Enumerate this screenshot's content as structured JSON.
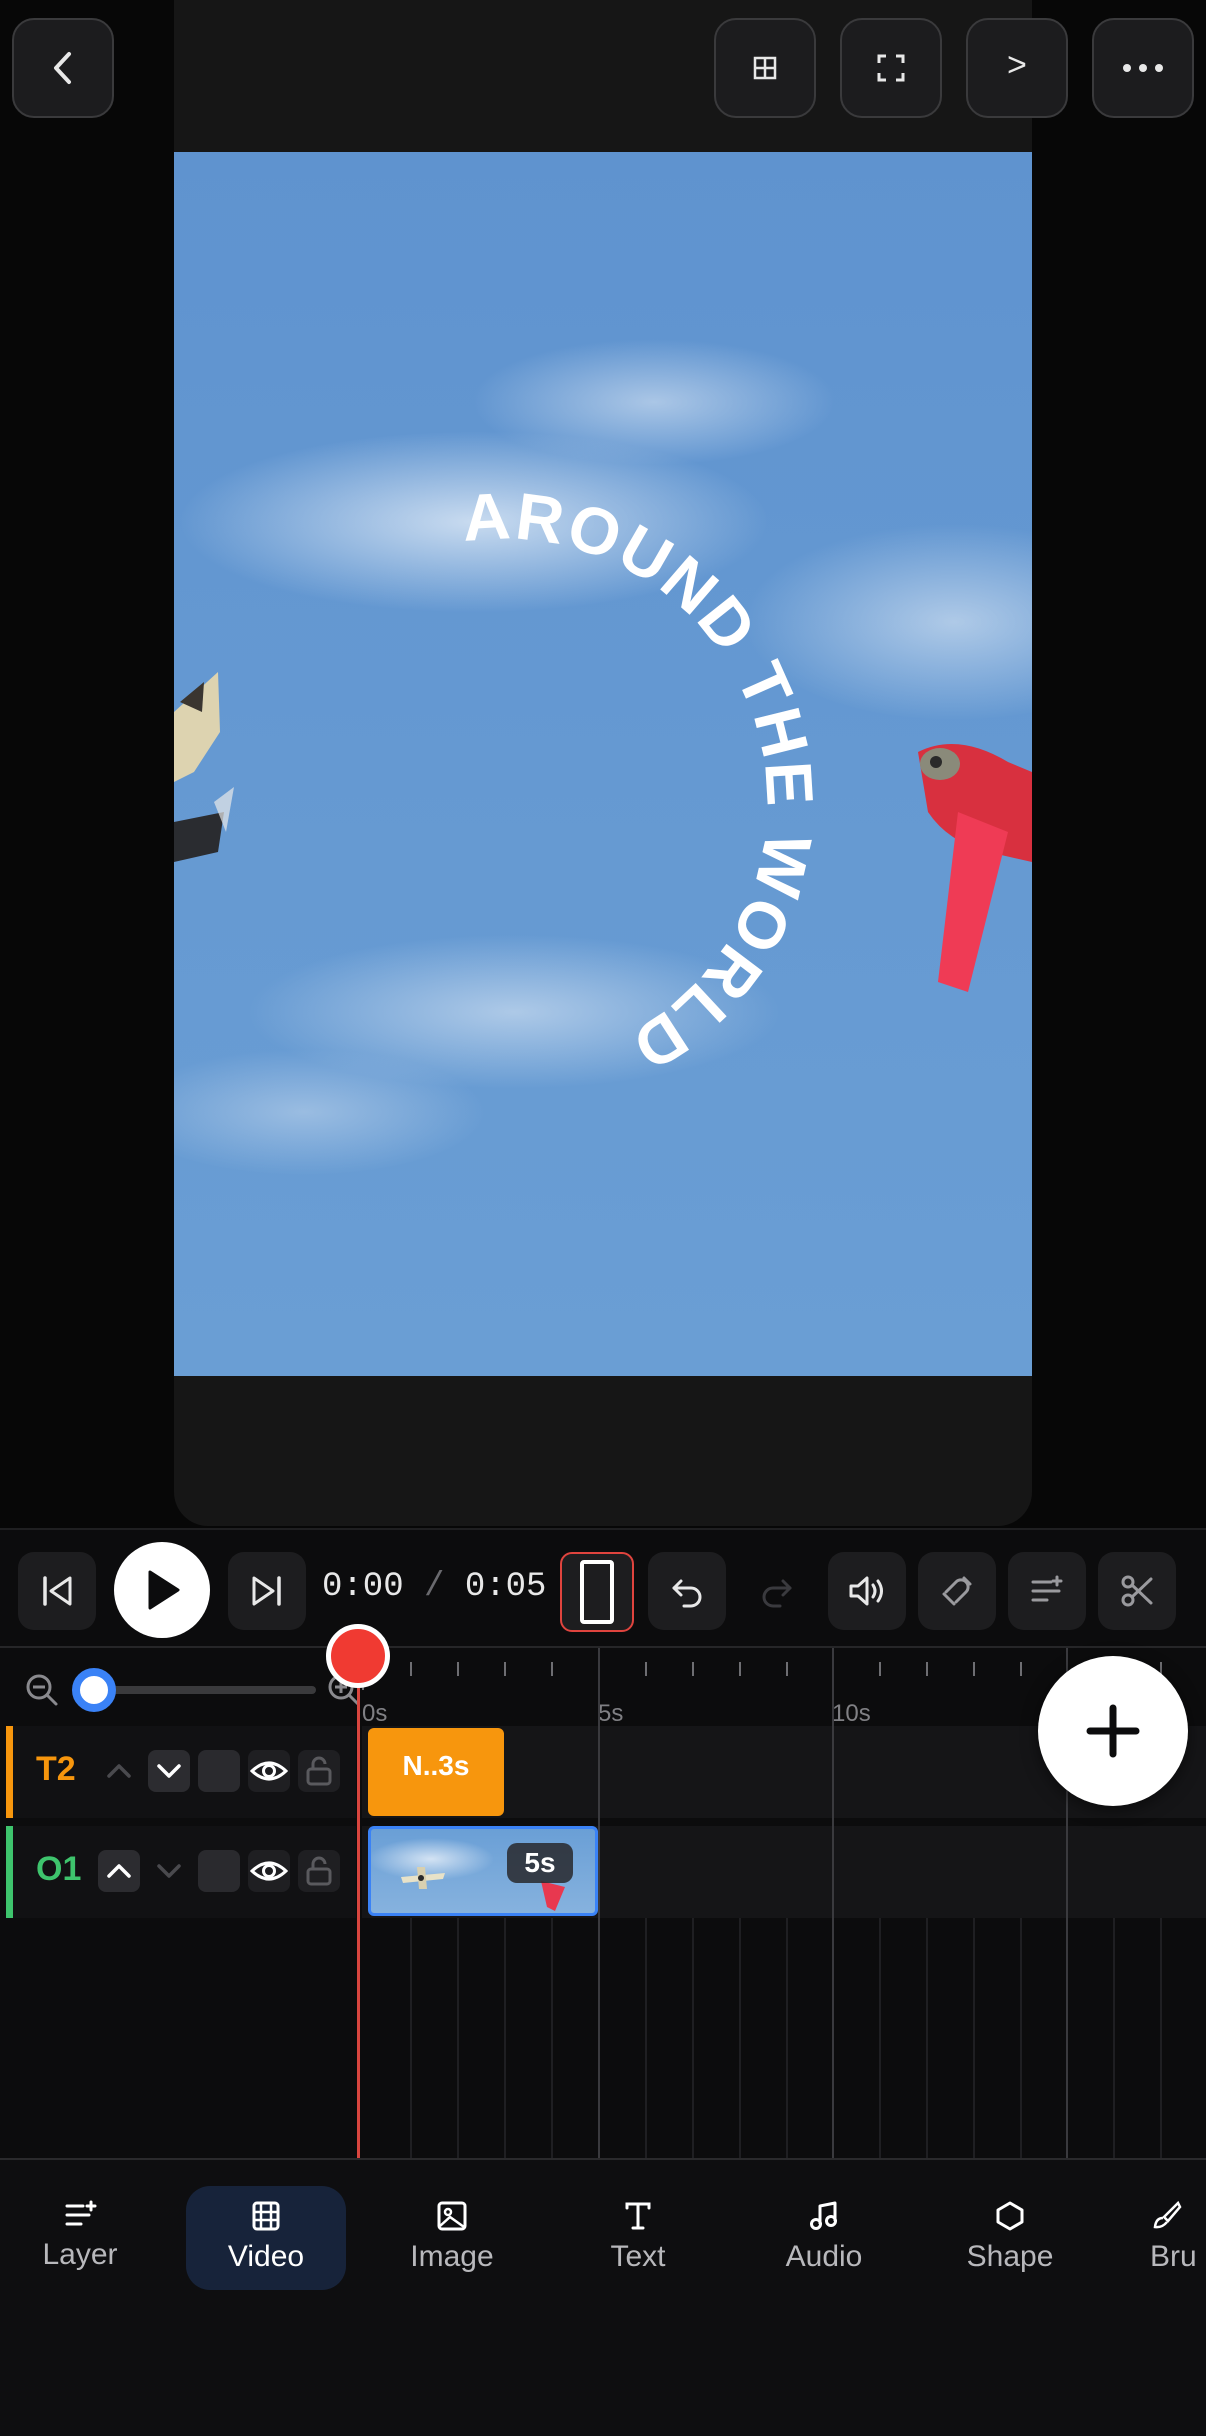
{
  "top_bar": {
    "back_icon": "chevron-left-icon",
    "grid_icon": "grid-icon",
    "fullscreen_icon": "fullscreen-icon",
    "console_label": ">",
    "more_icon": "more-horizontal-icon"
  },
  "preview": {
    "overlay_text": "AROUND THE WORLD"
  },
  "toolbar": {
    "current_time": "0:00",
    "separator": "/",
    "total_time": "0:05",
    "icons": [
      "skip-to-start-icon",
      "play-icon",
      "skip-to-end-icon",
      "aspect-ratio-icon",
      "undo-icon",
      "redo-icon",
      "volume-icon",
      "magnet-icon",
      "add-track-icon",
      "scissors-icon"
    ]
  },
  "timeline": {
    "zoom": {
      "level": 0.0
    },
    "ruler": {
      "labels": [
        "0s",
        "5s",
        "10s"
      ]
    },
    "tracks": [
      {
        "name": "T2",
        "color": "#f7960d",
        "clip_label": "N..3s"
      },
      {
        "name": "O1",
        "color": "#3ec46d",
        "clip_label": "5s"
      }
    ],
    "add_button_icon": "plus-icon"
  },
  "bottom_nav": {
    "items": [
      {
        "label": "Layer",
        "icon": "layer-icon"
      },
      {
        "label": "Video",
        "icon": "film-icon",
        "active": true
      },
      {
        "label": "Image",
        "icon": "image-icon"
      },
      {
        "label": "Text",
        "icon": "text-icon"
      },
      {
        "label": "Audio",
        "icon": "music-icon"
      },
      {
        "label": "Shape",
        "icon": "hexagon-icon"
      },
      {
        "label": "Bru",
        "icon": "brush-icon"
      }
    ]
  },
  "colors": {
    "accent_blue": "#3a82f6",
    "playhead": "#f03a32",
    "text_track": "#f7960d",
    "video_track": "#3ec46d"
  }
}
